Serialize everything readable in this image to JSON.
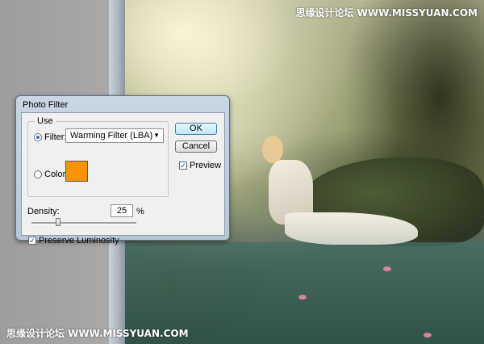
{
  "dialog": {
    "title": "Photo Filter",
    "use_group_label": "Use",
    "filter_label": "Filter:",
    "filter_value": "Warming Filter (LBA)",
    "color_label": "Color:",
    "color_swatch": "#ff9200",
    "ok_label": "OK",
    "cancel_label": "Cancel",
    "preview_label": "Preview",
    "preview_checked": true,
    "density_label": "Density:",
    "density_value": "25",
    "density_unit": "%",
    "density_percent": 25,
    "luminosity_label": "Preserve Luminosity",
    "luminosity_checked": true
  },
  "watermarks": {
    "top": "思缘设计论坛 WWW.MISSYUAN.COM",
    "bottom": "思缘设计论坛 WWW.MISSYUAN.COM"
  }
}
